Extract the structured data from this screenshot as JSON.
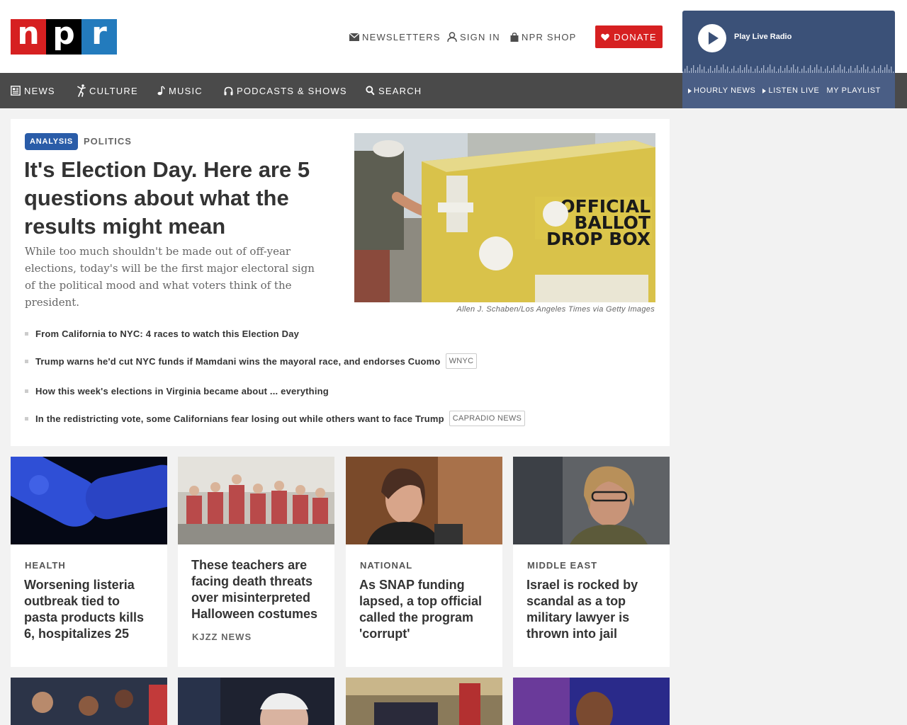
{
  "brand": {
    "letters": [
      "n",
      "p",
      "r"
    ],
    "colors": [
      "#d62021",
      "#000000",
      "#237bbd"
    ]
  },
  "utility": {
    "newsletters": "NEWSLETTERS",
    "sign_in": "SIGN IN",
    "shop": "NPR SHOP",
    "donate": "DONATE"
  },
  "nav": {
    "news": "NEWS",
    "culture": "CULTURE",
    "music": "MUSIC",
    "podcasts": "PODCASTS & SHOWS",
    "search": "SEARCH"
  },
  "player": {
    "play_label": "Play Live Radio",
    "hourly_news": "HOURLY NEWS",
    "listen_live": "LISTEN LIVE",
    "my_playlist": "MY PLAYLIST"
  },
  "feature": {
    "badge": "ANALYSIS",
    "kicker": "POLITICS",
    "headline": "It's Election Day. Here are 5 questions about what the results might mean",
    "teaser": "While too much shouldn't be made out of off-year elections, today's will be the first major electoral sign of the political mood and what voters think of the president.",
    "image": {
      "line1": "OFFICIAL",
      "line2": "BALLOT",
      "line3": "DROP BOX"
    },
    "credit": "Allen J. Schaben/Los Angeles Times via Getty Images",
    "related": [
      {
        "text": "From California to NYC: 4 races to watch this Election Day",
        "source": ""
      },
      {
        "text": "Trump warns he'd cut NYC funds if Mamdani wins the mayoral race, and endorses Cuomo",
        "source": "WNYC"
      },
      {
        "text": "How this week's elections in Virginia became about ... everything",
        "source": ""
      },
      {
        "text": "In the redistricting vote, some Californians fear losing out while others want to face Trump",
        "source": "CAPRADIO NEWS"
      }
    ]
  },
  "stories": [
    {
      "slug": "HEALTH",
      "title": "Worsening listeria outbreak tied to pasta products kills 6, hospitalizes 25",
      "org": ""
    },
    {
      "slug": "",
      "title": "These teachers are facing death threats over misinterpreted Halloween costumes",
      "org": "KJZZ NEWS"
    },
    {
      "slug": "NATIONAL",
      "title": "As SNAP funding lapsed, a top official called the program 'corrupt'",
      "org": ""
    },
    {
      "slug": "MIDDLE EAST",
      "title": "Israel is rocked by scandal as a top military lawyer is thrown into jail",
      "org": ""
    }
  ]
}
